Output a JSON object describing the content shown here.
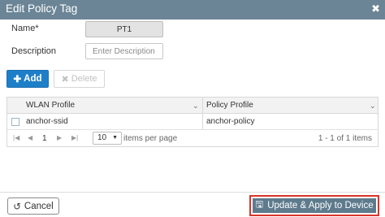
{
  "dialog": {
    "title": "Edit Policy Tag",
    "close_glyph": "✖"
  },
  "form": {
    "name_label": "Name*",
    "name_value": "PT1",
    "description_label": "Description",
    "description_placeholder": "Enter Description",
    "description_value": ""
  },
  "toolbar": {
    "add_label": "Add",
    "delete_label": "Delete"
  },
  "table": {
    "columns": [
      "WLAN Profile",
      "Policy Profile"
    ],
    "rows": [
      {
        "wlan_profile": "anchor-ssid",
        "policy_profile": "anchor-policy"
      }
    ]
  },
  "pagination": {
    "current_page": "1",
    "page_size": "10",
    "items_per_page_label": "items per page",
    "summary": "1 - 1 of 1 items"
  },
  "footer": {
    "cancel_label": "Cancel",
    "apply_label": "Update & Apply to Device"
  },
  "colors": {
    "title_bar": "#6b8596",
    "add_button": "#1e7fc9",
    "apply_button": "#5e7a8d",
    "highlight": "#d9342b"
  }
}
